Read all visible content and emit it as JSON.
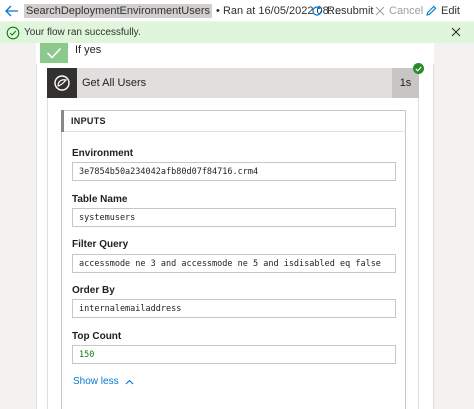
{
  "cmdbar": {
    "flow_name": "SearchDeploymentEnvironmentUsers",
    "run_info": "• Ran at 16/05/2022 08:...",
    "resubmit_label": "Resubmit",
    "cancel_label": "Cancel",
    "edit_label": "Edit"
  },
  "banner": {
    "message": "Your flow ran successfully."
  },
  "condition": {
    "label": "If yes"
  },
  "action": {
    "title": "Get All Users",
    "duration": "1s",
    "inputs_title": "INPUTS",
    "fields": [
      {
        "label": "Environment",
        "value": "3e7854b50a234042afb80d07f84716.crm4"
      },
      {
        "label": "Table Name",
        "value": "systemusers"
      },
      {
        "label": "Filter Query",
        "value": "accessmode ne 3 and accessmode ne 5 and isdisabled eq false"
      },
      {
        "label": "Order By",
        "value": "internalemailaddress"
      },
      {
        "label": "Top Count",
        "value": "150"
      }
    ],
    "show_less_label": "Show less"
  }
}
